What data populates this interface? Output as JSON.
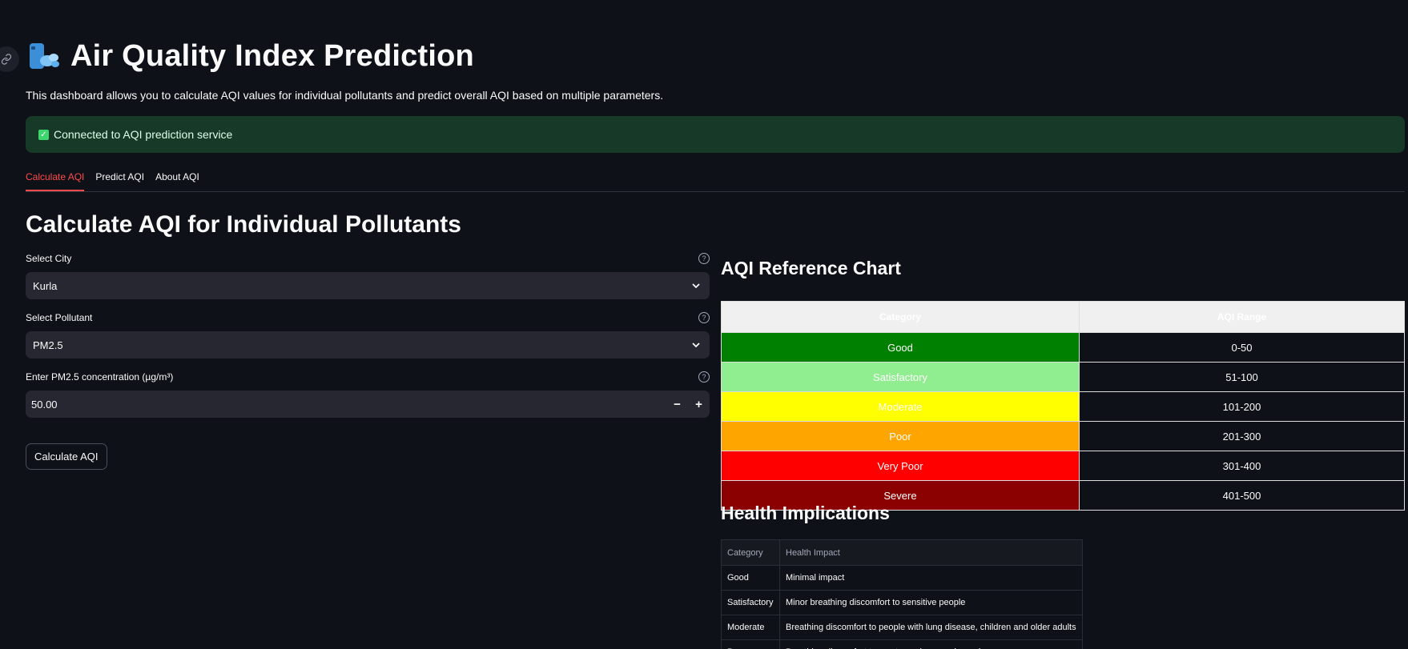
{
  "header": {
    "title": "Air Quality Index Prediction",
    "description": "This dashboard allows you to calculate AQI values for individual pollutants and predict overall AQI based on multiple parameters."
  },
  "status": {
    "message": "Connected to AQI prediction service",
    "icon": "check-icon",
    "color": "#173928"
  },
  "tabs": [
    {
      "label": "Calculate AQI",
      "active": true
    },
    {
      "label": "Predict AQI",
      "active": false
    },
    {
      "label": "About AQI",
      "active": false
    }
  ],
  "section": {
    "title": "Calculate AQI for Individual Pollutants"
  },
  "form": {
    "city": {
      "label": "Select City",
      "value": "Kurla"
    },
    "pollutant": {
      "label": "Select Pollutant",
      "value": "PM2.5"
    },
    "concentration": {
      "label": "Enter PM2.5 concentration (µg/m³)",
      "value": "50.00",
      "decrement": "−",
      "increment": "+"
    },
    "submit_label": "Calculate AQI"
  },
  "reference": {
    "title": "AQI Reference Chart",
    "headers": [
      "Category",
      "AQI Range"
    ],
    "rows": [
      {
        "category": "Good",
        "range": "0-50",
        "color": "#008000"
      },
      {
        "category": "Satisfactory",
        "range": "51-100",
        "color": "#90ee90"
      },
      {
        "category": "Moderate",
        "range": "101-200",
        "color": "#ffff00"
      },
      {
        "category": "Poor",
        "range": "201-300",
        "color": "#ffa500"
      },
      {
        "category": "Very Poor",
        "range": "301-400",
        "color": "#ff0000"
      },
      {
        "category": "Severe",
        "range": "401-500",
        "color": "#8b0000"
      }
    ]
  },
  "health": {
    "title": "Health Implications",
    "headers": [
      "Category",
      "Health Impact"
    ],
    "rows": [
      {
        "category": "Good",
        "impact": "Minimal impact"
      },
      {
        "category": "Satisfactory",
        "impact": "Minor breathing discomfort to sensitive people"
      },
      {
        "category": "Moderate",
        "impact": "Breathing discomfort to people with lung disease, children and older adults"
      },
      {
        "category": "Poor",
        "impact": "Breathing discomfort to most people on prolonged exposure"
      }
    ]
  }
}
